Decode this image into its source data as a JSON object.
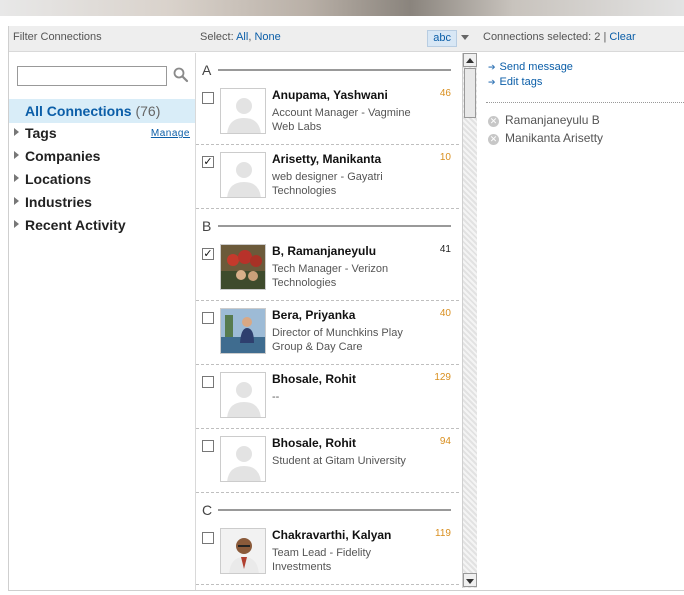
{
  "filter": {
    "title": "Filter Connections",
    "all_label": "All Connections",
    "all_count": "(76)",
    "items": [
      {
        "label": "Tags",
        "action": "Manage"
      },
      {
        "label": "Companies"
      },
      {
        "label": "Locations"
      },
      {
        "label": "Industries"
      },
      {
        "label": "Recent Activity"
      }
    ],
    "search_placeholder": ""
  },
  "list_header": {
    "select_label": "Select:",
    "all": "All",
    "sep": ",",
    "none": "None",
    "sort": "abc"
  },
  "groups": [
    {
      "letter": "A"
    },
    {
      "letter": "B"
    },
    {
      "letter": "C"
    }
  ],
  "connections": [
    {
      "name": "Anupama, Yashwani",
      "headline": "Account Manager - Vagmine Web Labs",
      "count": "46",
      "checked": false
    },
    {
      "name": "Arisetty, Manikanta",
      "headline": "web designer - Gayatri Technologies",
      "count": "10",
      "checked": true
    },
    {
      "name": "B, Ramanjaneyulu",
      "headline": "Tech Manager - Verizon Technologies",
      "count": "41",
      "checked": true
    },
    {
      "name": "Bera, Priyanka",
      "headline": "Director of Munchkins Play Group & Day Care",
      "count": "40",
      "checked": false
    },
    {
      "name": "Bhosale, Rohit",
      "headline": "--",
      "count": "129",
      "checked": false
    },
    {
      "name": "Bhosale, Rohit",
      "headline": "Student at Gitam University",
      "count": "94",
      "checked": false
    },
    {
      "name": "Chakravarthi, Kalyan",
      "headline": "Team Lead - Fidelity Investments",
      "count": "119",
      "checked": false
    }
  ],
  "selection": {
    "label": "Connections selected: 2",
    "sep": "|",
    "clear": "Clear",
    "actions": [
      "Send message",
      "Edit tags"
    ],
    "selected": [
      "Ramanjaneyulu B",
      "Manikanta Arisetty"
    ]
  },
  "colors": {
    "link": "#0b5ea8",
    "count": "#d98f1f",
    "highlight": "#d9edf8"
  }
}
